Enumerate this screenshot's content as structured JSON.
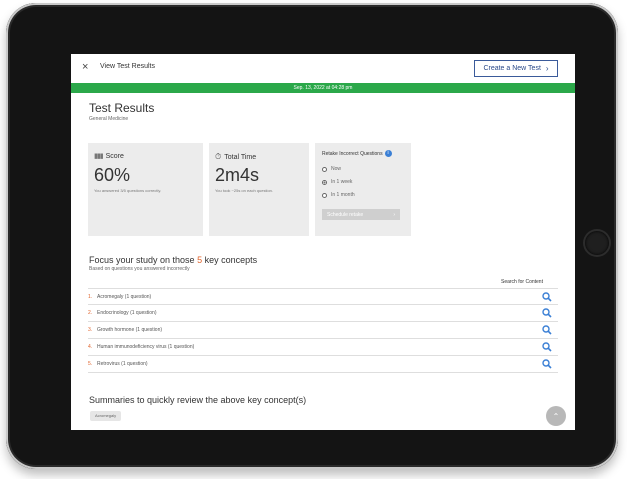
{
  "topbar": {
    "title": "View Test Results",
    "create_label": "Create a New Test",
    "close_glyph": "×",
    "chevron": "›"
  },
  "date_banner": "Sep. 13, 2022 at 04:28 pm",
  "results": {
    "title": "Test Results",
    "subtitle": "General Medicine"
  },
  "score_card": {
    "label": "Score",
    "value": "60%",
    "note": "You answered 3/5 questions correctly."
  },
  "time_card": {
    "label": "Total Time",
    "value": "2m4s",
    "note": "You took ~25s on each question."
  },
  "retake": {
    "title": "Retake Incorrect Questions",
    "options": [
      {
        "label": "Now",
        "selected": false
      },
      {
        "label": "In 1 week",
        "selected": true
      },
      {
        "label": "In 1 month",
        "selected": false
      }
    ],
    "schedule_label": "Schedule retake"
  },
  "focus": {
    "title_prefix": "Focus your study on those",
    "count": "5",
    "title_suffix": "key concepts",
    "subtitle": "Based on questions you answered incorrectly",
    "search_label": "Search for Content",
    "concepts": [
      {
        "num": "1.",
        "label": "Acromegaly (1 question)"
      },
      {
        "num": "2.",
        "label": "Endocrinology (1 question)"
      },
      {
        "num": "3.",
        "label": "Growth hormone (1 question)"
      },
      {
        "num": "4.",
        "label": "Human immunodeficiency virus (1 question)"
      },
      {
        "num": "5.",
        "label": "Retrovirus (1 question)"
      }
    ]
  },
  "summaries": {
    "title": "Summaries to quickly review the above key concept(s)",
    "tag": "Acromegaly"
  },
  "colors": {
    "banner": "#2ba84a",
    "accent": "#e0622a",
    "search": "#3a7fd5"
  },
  "icons": {
    "score": "bar-chart-icon",
    "time": "stopwatch-icon",
    "info": "info-icon",
    "search": "magnifier-icon",
    "scroll": "chevron-up-icon"
  }
}
